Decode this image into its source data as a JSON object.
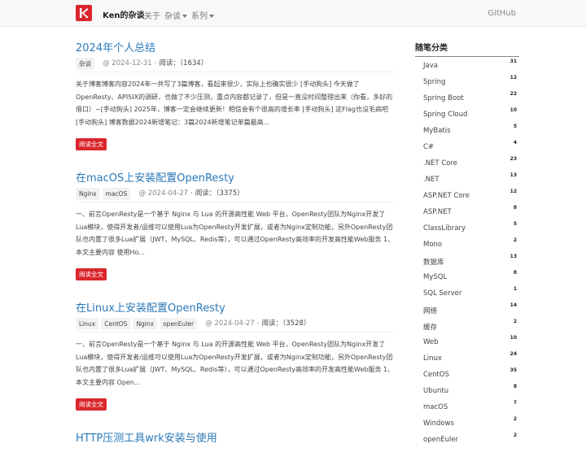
{
  "nav": {
    "brand": "Ken的杂谈",
    "about": "关于",
    "misc": "杂谈",
    "series": "系列",
    "github": "GitHub"
  },
  "posts": [
    {
      "title": "2024年个人总结",
      "tags": [
        "杂谈"
      ],
      "date": "@ 2024-12-31",
      "reads_label": "阅读：",
      "reads": "（1634）",
      "summary": "关于博客博客内容2024年一共写了3篇博客，看起来很少，实际上也确实很少 [手动狗头] 今天做了OpenResty、APISIX的调研，也做了不少压测，重点内容都记录了，但是一直没时间整理出来（你看，多好的借口）~[手动狗头] 2025年，博客一定会继续更新！相信会有个很高的增长率 [手动狗头] 这Flag也没毛病吧 [手动狗头] 博客数据2024新增笔记：3篇2024新增笔记单篇最高...",
      "button": "阅读全文"
    },
    {
      "title": "在macOS上安装配置OpenResty",
      "tags": [
        "Nginx",
        "macOS"
      ],
      "date": "@ 2024-04-27",
      "reads_label": "阅读：",
      "reads": "（3375）",
      "summary": "一、前言OpenResty是一个基于 Nginx 与 Lua 的开源高性能 Web 平台，OpenResty团队为Nginx开发了Lua模块，使得开发者/运维可以使用Lua为OpenResty开发扩展，或者为Nginx定制功能，另外OpenResty团队也内置了很多Lua扩展（JWT、MySQL、Redis等），可以通过OpenResty高效率的开发高性能Web服务 1、本文主要内容 使用Ho...",
      "button": "阅读全文"
    },
    {
      "title": "在Linux上安装配置OpenResty",
      "tags": [
        "Linux",
        "CentOS",
        "Nginx",
        "openEuler"
      ],
      "date": "@ 2024-04-27",
      "reads_label": "阅读：",
      "reads": "（3528）",
      "summary": "一、前言OpenResty是一个基于 Nginx 与 Lua 的开源高性能 Web 平台，OpenResty团队为Nginx开发了Lua模块，使得开发者/运维可以使用Lua为OpenResty开发扩展，或者为Nginx定制功能，另外OpenResty团队也内置了很多Lua扩展（JWT、MySQL、Redis等），可以通过OpenResty高效率的开发高性能Web服务 1、本文主要内容 Open...",
      "button": "阅读全文"
    },
    {
      "title": "HTTP压测工具wrk安装与使用"
    }
  ],
  "sidebar": {
    "title": "随笔分类",
    "categories": [
      {
        "name": "Java",
        "count": "31"
      },
      {
        "name": "Spring",
        "count": "12"
      },
      {
        "name": "Spring Boot",
        "count": "22"
      },
      {
        "name": "Spring Cloud",
        "count": "10"
      },
      {
        "name": "MyBatis",
        "count": "5"
      },
      {
        "name": "C#",
        "count": "4"
      },
      {
        "name": ".NET Core",
        "count": "23"
      },
      {
        "name": ".NET",
        "count": "13"
      },
      {
        "name": "ASP.NET Core",
        "count": "12"
      },
      {
        "name": "ASP.NET",
        "count": "8"
      },
      {
        "name": "ClassLibrary",
        "count": "5"
      },
      {
        "name": "Mono",
        "count": "2"
      },
      {
        "name": "数据库",
        "count": "13"
      },
      {
        "name": "MySQL",
        "count": "8"
      },
      {
        "name": "SQL Server",
        "count": "1"
      },
      {
        "name": "网络",
        "count": "14"
      },
      {
        "name": "缓存",
        "count": "2"
      },
      {
        "name": "Web",
        "count": "10"
      },
      {
        "name": "Linux",
        "count": "24"
      },
      {
        "name": "CentOS",
        "count": "35"
      },
      {
        "name": "Ubuntu",
        "count": "8"
      },
      {
        "name": "macOS",
        "count": "7"
      },
      {
        "name": "Windows",
        "count": "2"
      },
      {
        "name": "openEuler",
        "count": "2"
      }
    ]
  }
}
